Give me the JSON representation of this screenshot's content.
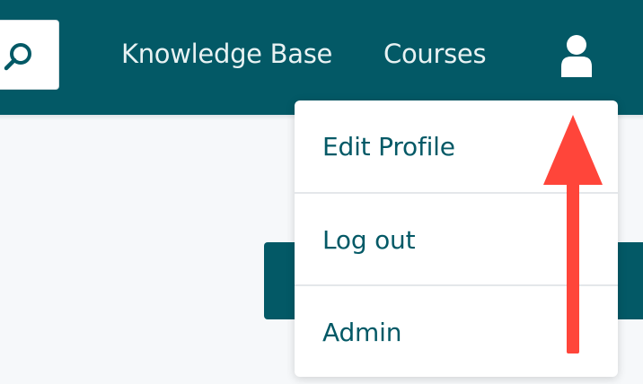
{
  "nav": {
    "links": [
      "Knowledge Base",
      "Courses"
    ],
    "search_icon": "search-icon",
    "user_icon": "user-icon"
  },
  "dropdown": {
    "items": [
      "Edit Profile",
      "Log out",
      "Admin"
    ]
  },
  "annotation": {
    "arrow_color": "#ff453a"
  },
  "colors": {
    "brand": "#035966",
    "menu_text": "#035966",
    "nav_text": "#e8f2f3",
    "background": "#f6f8fa"
  }
}
